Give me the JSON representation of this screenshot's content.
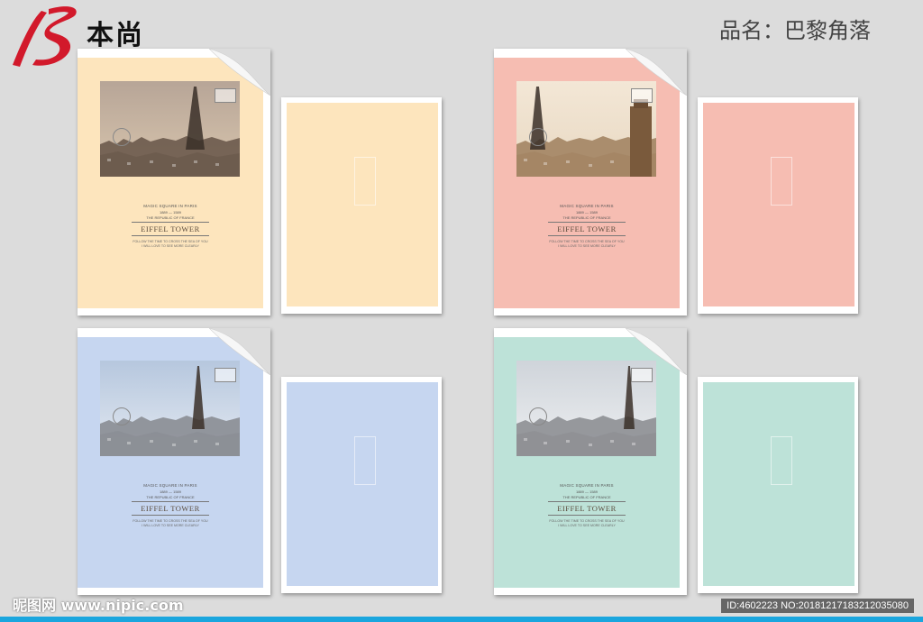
{
  "brand": {
    "logo_mark": "15",
    "name": "本尚"
  },
  "header": {
    "product_label": "品名：巴黎角落"
  },
  "notebooks": [
    {
      "front_color": "#fde5bd",
      "back_color": "#fde5bd",
      "photo_scene": "eiffel-sunset",
      "stamp_text": "1889",
      "line1": "MAGIC SQUARE IN PARIS",
      "line2": "1889 — 1589",
      "line3": "THE REPUBLIC OF FRANCE",
      "title": "EIFFEL TOWER",
      "line4": "FOLLOW THE TIME TO CROSS THE SEA OF YOU",
      "line5": "I WILL LOVE TO SEE MORE CLEARLY"
    },
    {
      "front_color": "#f6bdb2",
      "back_color": "#f6bdb2",
      "photo_scene": "paris-church",
      "stamp_text": "1889",
      "line1": "MAGIC SQUARE IN PARIS",
      "line2": "1889 — 1589",
      "line3": "THE REPUBLIC OF FRANCE",
      "title": "EIFFEL TOWER",
      "line4": "FOLLOW THE TIME TO CROSS THE SEA OF YOU",
      "line5": "I WILL LOVE TO SEE MORE CLEARLY"
    },
    {
      "front_color": "#c6d6f0",
      "back_color": "#c6d6f0",
      "photo_scene": "paris-day",
      "stamp_text": "1889",
      "line1": "MAGIC SQUARE IN PARIS",
      "line2": "1889 — 1589",
      "line3": "THE REPUBLIC OF FRANCE",
      "title": "EIFFEL TOWER",
      "line4": "FOLLOW THE TIME TO CROSS THE SEA OF YOU",
      "line5": "I WILL LOVE TO SEE MORE CLEARLY"
    },
    {
      "front_color": "#bde2d8",
      "back_color": "#bde2d8",
      "photo_scene": "paris-cloudy",
      "stamp_text": "1889",
      "line1": "MAGIC SQUARE IN PARIS",
      "line2": "1889 — 1589",
      "line3": "THE REPUBLIC OF FRANCE",
      "title": "EIFFEL TOWER",
      "line4": "FOLLOW THE TIME TO CROSS THE SEA OF YOU",
      "line5": "I WILL LOVE TO SEE MORE CLEARLY"
    }
  ],
  "footer": {
    "site_watermark": "昵图网 www.nipic.com",
    "id_text": "ID:4602223 NO:20181217183212035080"
  }
}
